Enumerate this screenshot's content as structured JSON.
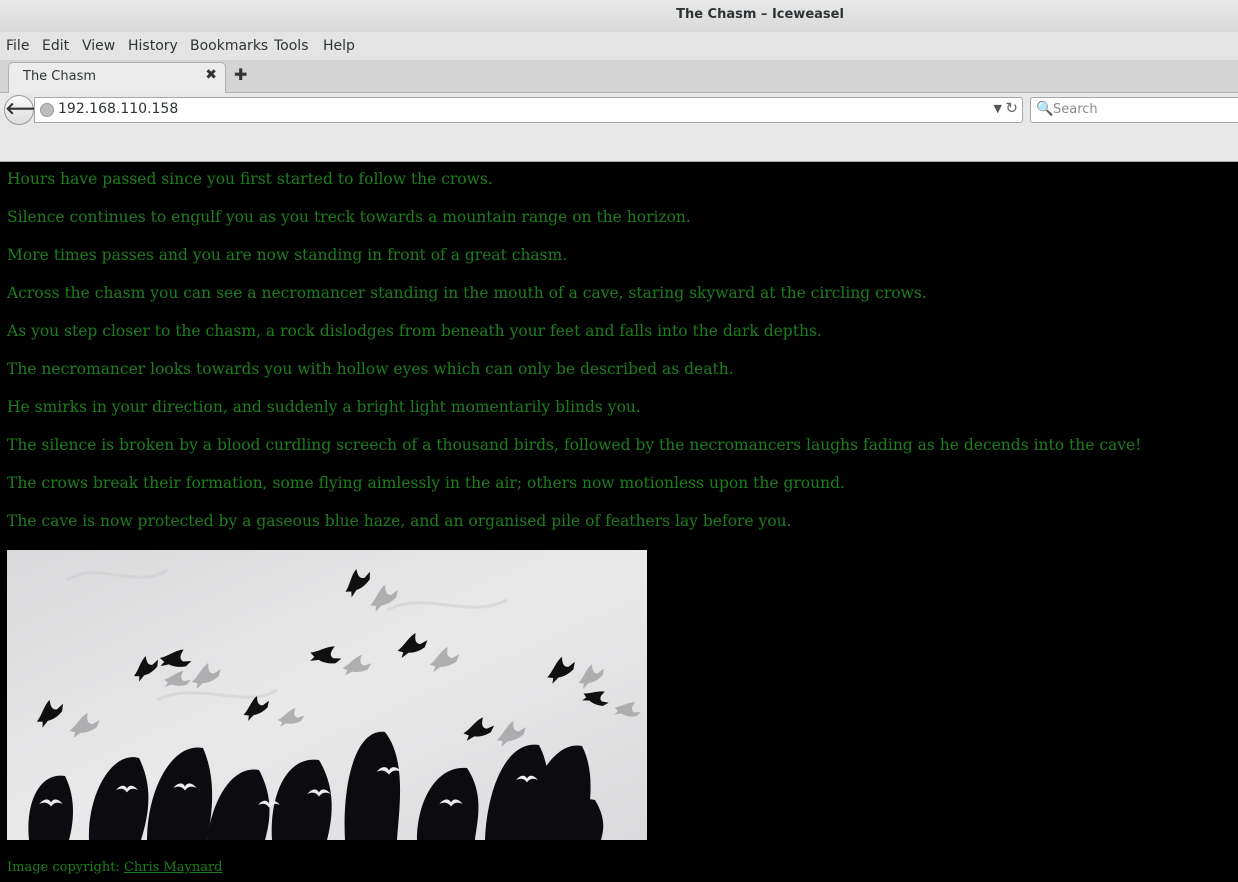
{
  "window": {
    "title": "The Chasm – Iceweasel"
  },
  "menubar": {
    "items": [
      "File",
      "Edit",
      "View",
      "History",
      "Bookmarks",
      "Tools",
      "Help"
    ]
  },
  "tabs": [
    {
      "label": "The Chasm",
      "close_icon": "close-icon"
    }
  ],
  "newtab": {
    "icon": "plus-icon"
  },
  "toolbar": {
    "url": "192.168.110.158",
    "search_placeholder": "Search"
  },
  "page": {
    "paragraphs": [
      "Hours have passed since you first started to follow the crows.",
      "Silence continues to engulf you as you treck towards a mountain range on the horizon.",
      "More times passes and you are now standing in front of a great chasm.",
      "Across the chasm you can see a necromancer standing in the mouth of a cave, staring skyward at the circling crows.",
      "As you step closer to the chasm, a rock dislodges from beneath your feet and falls into the dark depths.",
      "The necromancer looks towards you with hollow eyes which can only be described as death.",
      "He smirks in your direction, and suddenly a bright light momentarily blinds you.",
      "The silence is broken by a blood curdling screech of a thousand birds, followed by the necromancers laughs fading as he decends into the cave!",
      "The crows break their formation, some flying aimlessly in the air; others now motionless upon the ground.",
      "The cave is now protected by a gaseous blue haze, and an organised pile of feathers lay before you."
    ],
    "credit_prefix": "Image copyright: ",
    "credit_link": "Chris Maynard"
  },
  "colors": {
    "text_green": "#1d7e1d",
    "background": "#000000"
  }
}
